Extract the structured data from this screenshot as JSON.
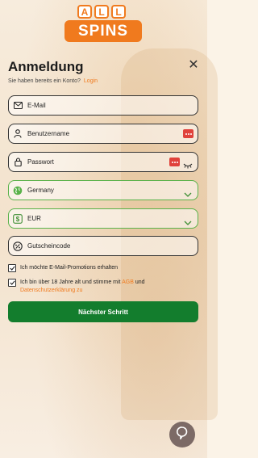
{
  "brand": {
    "logo_top": [
      "A",
      "L",
      "L"
    ],
    "logo_bottom": "SPINS",
    "accent": "#f07a1e"
  },
  "dialog": {
    "title": "Anmeldung",
    "close_symbol": "✕",
    "subline": "Sie haben bereits ein Konto?",
    "login_link": "Login"
  },
  "form": {
    "email": {
      "placeholder": "E-Mail",
      "icon": "envelope-icon"
    },
    "username": {
      "placeholder": "Benutzername",
      "icon": "user-icon"
    },
    "password": {
      "placeholder": "Passwort",
      "icon": "lock-icon"
    },
    "country": {
      "value": "Germany",
      "icon": "globe-icon"
    },
    "currency": {
      "value": "EUR",
      "icon": "money-icon"
    },
    "promo": {
      "placeholder": "Gutscheincode",
      "icon": "voucher-icon"
    },
    "checkbox_promotions": {
      "label": "Ich möchte E-Mail-Promotions erhalten",
      "checked": true
    },
    "checkbox_terms": {
      "label_start": "Ich bin über 18 Jahre alt und stimme mit",
      "agb": "AGB",
      "label_and": "und",
      "privacy": "Datenschutzerklärung zu",
      "checked": true
    },
    "submit_label": "Nächster Schritt"
  },
  "colors": {
    "field_border_active": "#5ab24a",
    "submit_bg": "#137d2d",
    "danger": "#e0423b"
  }
}
